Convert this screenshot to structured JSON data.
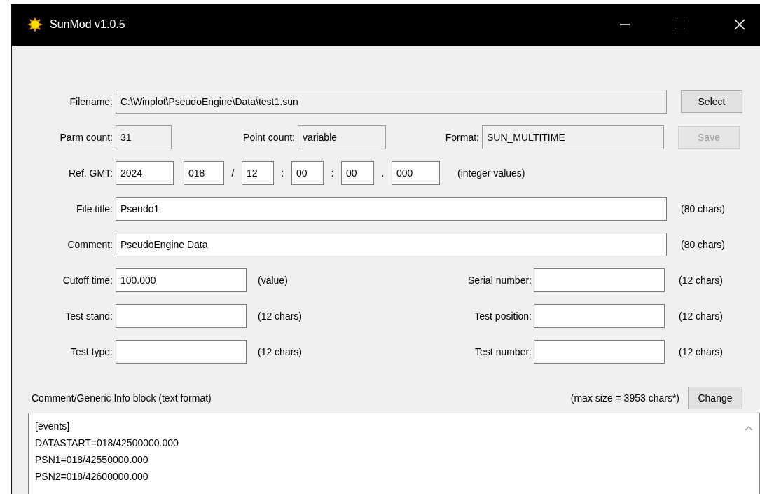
{
  "window": {
    "title": "SunMod v1.0.5"
  },
  "filename": {
    "label": "Filename:",
    "value": "C:\\Winplot\\PseudoEngine\\Data\\test1.sun",
    "readonly": true
  },
  "select_button": {
    "label": "Select",
    "disabled": false
  },
  "parm_count": {
    "label": "Parm count:",
    "value": "31",
    "readonly": true
  },
  "point_count": {
    "label": "Point count:",
    "value": "variable",
    "readonly": true
  },
  "format": {
    "label": "Format:",
    "value": "SUN_MULTITIME",
    "readonly": true
  },
  "save_button": {
    "label": "Save",
    "disabled": true
  },
  "ref_gmt": {
    "label": "Ref. GMT:",
    "parts": [
      {
        "value": "2024"
      },
      {
        "value": "018",
        "sep": "/"
      },
      {
        "value": "12",
        "sep": ":"
      },
      {
        "value": "00",
        "sep": ":"
      },
      {
        "value": "00",
        "sep": "."
      },
      {
        "value": "000"
      }
    ],
    "hint": "(integer values)"
  },
  "file_title": {
    "label": "File title:",
    "value": "Pseudo1",
    "hint": "(80 chars)",
    "readonly": false
  },
  "comment": {
    "label": "Comment:",
    "value": "PseudoEngine Data",
    "hint": "(80 chars)",
    "readonly": false
  },
  "pairs": [
    {
      "left": {
        "label": "Cutoff time:",
        "value": "100.000",
        "hint": "(value)"
      },
      "right": {
        "label": "Serial number:",
        "hint": "(12 chars)"
      }
    },
    {
      "left": {
        "label": "Test stand:",
        "hint": "(12 chars)"
      },
      "right": {
        "label": "Test position:",
        "hint": "(12 chars)"
      }
    },
    {
      "left": {
        "label": "Test type:",
        "hint": "(12 chars)"
      },
      "right": {
        "label": "Test number:",
        "hint": "(12 chars)"
      }
    }
  ],
  "info_block": {
    "label": "Comment/Generic Info block (text format)",
    "limit": "(max size = 3953 chars*)",
    "button": "Change",
    "lines": [
      "[events]",
      "DATASTART=018/42500000.000",
      "PSN1=018/42550000.000",
      "PSN2=018/42600000.000"
    ]
  }
}
